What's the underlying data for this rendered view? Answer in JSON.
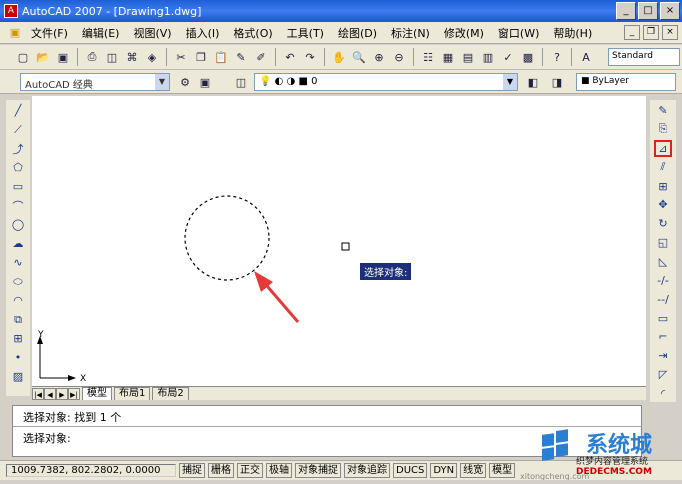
{
  "window": {
    "title": "AutoCAD 2007 - [Drawing1.dwg]",
    "min": "_",
    "max": "□",
    "close": "×"
  },
  "doc_controls": {
    "min": "_",
    "restore": "❐",
    "close": "×"
  },
  "menu": [
    "文件(F)",
    "编辑(E)",
    "视图(V)",
    "插入(I)",
    "格式(O)",
    "工具(T)",
    "绘图(D)",
    "标注(N)",
    "修改(M)",
    "窗口(W)",
    "帮助(H)"
  ],
  "toolbar": {
    "text_style": "Standard"
  },
  "workspace": {
    "value": "AutoCAD 经典"
  },
  "layer": {
    "value": "0"
  },
  "color_control": {
    "value": "ByLayer"
  },
  "canvas": {
    "tooltip": "选择对象:",
    "ucs_x": "X",
    "ucs_y": "Y"
  },
  "tabs": [
    {
      "label": "模型",
      "active": true
    },
    {
      "label": "布局1",
      "active": false
    },
    {
      "label": "布局2",
      "active": false
    }
  ],
  "command": {
    "line1": "选择对象: 找到 1 个",
    "line2": "选择对象:"
  },
  "status": {
    "coords": "1009.7382, 802.2802, 0.0000",
    "buttons": [
      "捕捉",
      "栅格",
      "正交",
      "极轴",
      "对象捕捉",
      "对象追踪",
      "DUCS",
      "DYN",
      "线宽",
      "模型"
    ]
  },
  "watermark": {
    "text1": "系统城",
    "text2": "织梦内容管理系统",
    "text3": "DEDECMS.COM",
    "text4": "xitongcheng.com"
  },
  "colors": {
    "title_bar": "#2b6ce6",
    "highlight_box": "#e02020",
    "arrow": "#e53a3a",
    "tooltip_bg": "#1e2f7a"
  }
}
